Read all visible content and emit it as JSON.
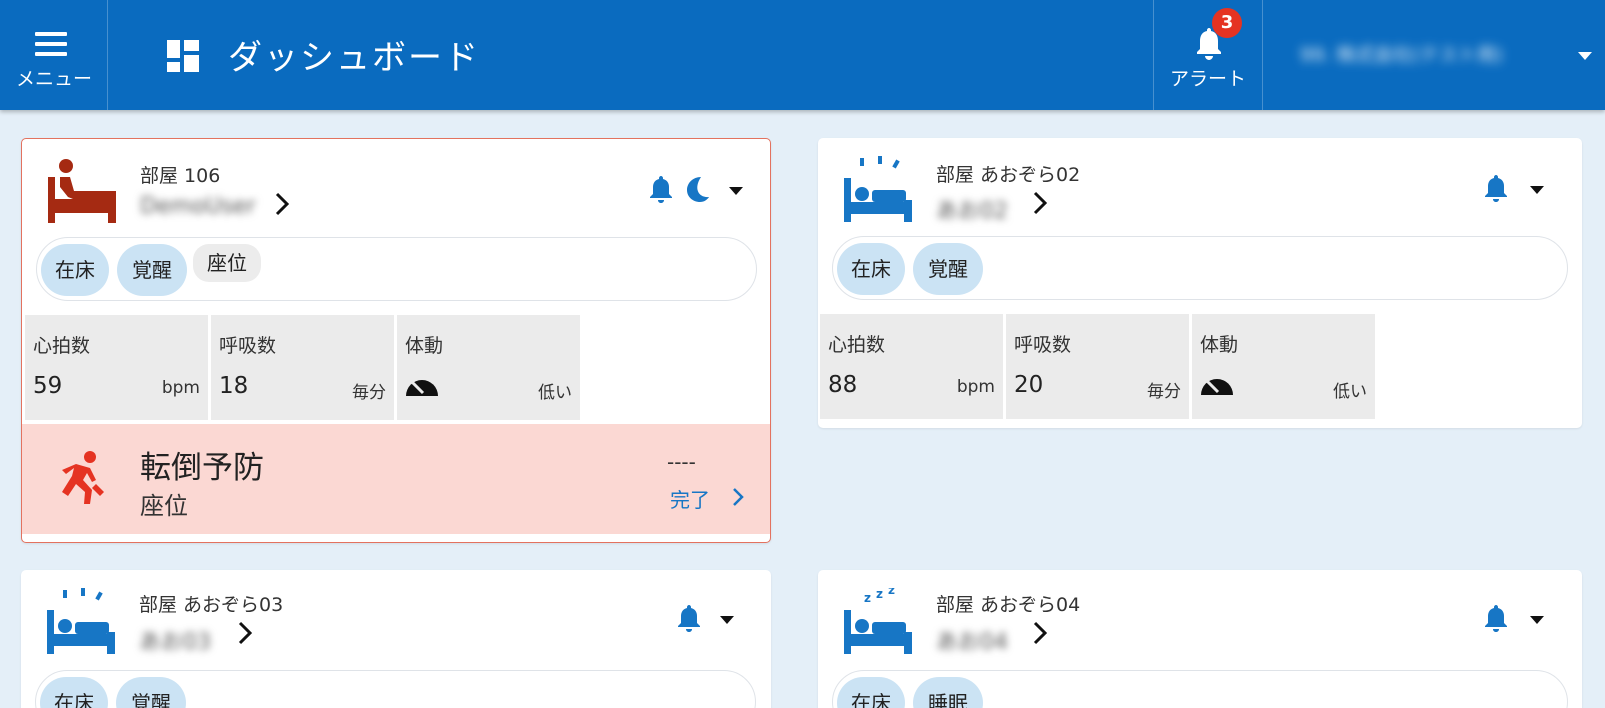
{
  "header": {
    "menu_label": "メニュー",
    "title": "ダッシュボード",
    "alert_label": "アラート",
    "alert_count": "3",
    "user_name": "99. 株式会社(テスト用)"
  },
  "colors": {
    "header_bg": "#0a6bbf",
    "accent": "#1776c5",
    "alert_bg": "#fbd8d3",
    "alert_icon": "#e53322",
    "occupied_icon": "#a52a12"
  },
  "icons": {
    "menu": "hamburger-icon",
    "dashboard": "dashboard-grid-icon",
    "alert": "bell-icon",
    "fall": "fall-person-icon",
    "sleep": "moon-icon",
    "body_motion": "gauge-icon"
  },
  "cards": [
    {
      "room": "部屋 106",
      "resident": "DemoUser",
      "chips": [
        "在床",
        "覚醒",
        "座位"
      ],
      "metrics": [
        {
          "label": "心拍数",
          "value": "59",
          "unit": "bpm"
        },
        {
          "label": "呼吸数",
          "value": "18",
          "unit": "毎分"
        },
        {
          "label": "体動",
          "value": "",
          "unit": "低い"
        }
      ],
      "alert": {
        "title": "転倒予防",
        "subtitle": "座位",
        "time": "----",
        "action": "完了"
      }
    },
    {
      "room": "部屋 あおぞら02",
      "resident": "あお02",
      "chips": [
        "在床",
        "覚醒"
      ],
      "metrics": [
        {
          "label": "心拍数",
          "value": "88",
          "unit": "bpm"
        },
        {
          "label": "呼吸数",
          "value": "20",
          "unit": "毎分"
        },
        {
          "label": "体動",
          "value": "",
          "unit": "低い"
        }
      ]
    },
    {
      "room": "部屋 あおぞら03",
      "resident": "あお03",
      "chips": [
        "在床",
        "覚醒"
      ]
    },
    {
      "room": "部屋 あおぞら04",
      "resident": "あお04",
      "chips": [
        "在床",
        "睡眠"
      ]
    }
  ]
}
